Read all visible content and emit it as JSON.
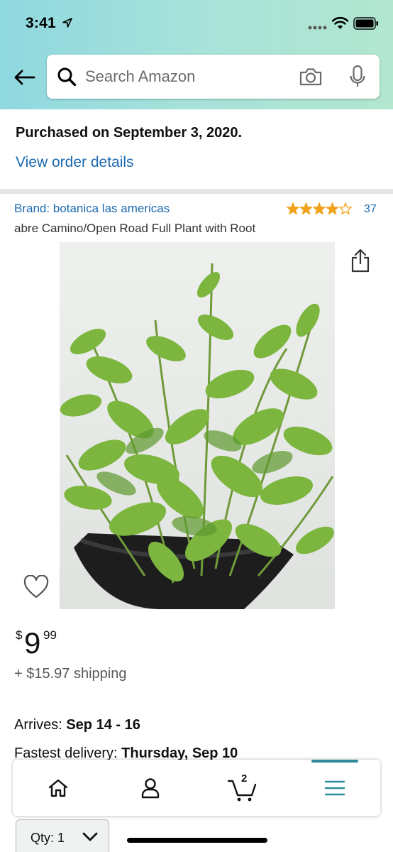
{
  "status_bar": {
    "time": "3:41"
  },
  "search": {
    "placeholder": "Search Amazon"
  },
  "order": {
    "purchased_text": "Purchased on September 3, 2020.",
    "view_details_label": "View order details"
  },
  "product": {
    "brand": "Brand: botanica las americas",
    "rating": 4,
    "rating_max": 5,
    "rating_count": "37",
    "title": "abre Camino/Open Road Full Plant with Root",
    "price_symbol": "$",
    "price_whole": "9",
    "price_fraction": "99",
    "shipping": "+ $15.97 shipping",
    "arrives_label": "Arrives: ",
    "arrives_value": "Sep 14 - 16",
    "fastest_label": "Fastest delivery: ",
    "fastest_value": "Thursday, Sep 10"
  },
  "bottom_nav": {
    "items": [
      {
        "name": "home",
        "icon": "home-icon"
      },
      {
        "name": "account",
        "icon": "account-icon"
      },
      {
        "name": "cart",
        "icon": "cart-icon",
        "count": "2"
      },
      {
        "name": "menu",
        "icon": "hamburger-menu-icon",
        "active": true
      }
    ],
    "accent_color": "#2f8a9a"
  },
  "quantity": {
    "label": "Qty: 1"
  },
  "colors": {
    "link": "#1c6ab0",
    "star": "#f0a21a",
    "header_gradient_start": "#8fd8e0",
    "header_gradient_end": "#b2e6cf"
  }
}
